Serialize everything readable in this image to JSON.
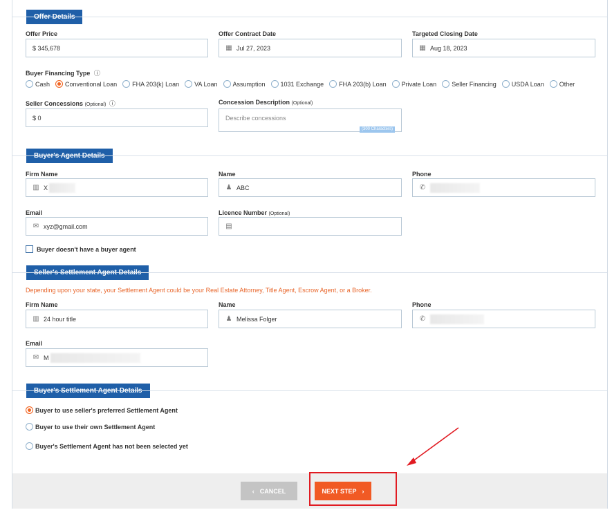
{
  "offer": {
    "title": "Offer Details",
    "offer_price_label": "Offer Price",
    "offer_price_value": "$ 345,678",
    "contract_date_label": "Offer Contract Date",
    "contract_date_value": "Jul 27, 2023",
    "closing_date_label": "Targeted Closing Date",
    "closing_date_value": "Aug 18, 2023",
    "financing_label": "Buyer Financing Type",
    "financing_options": [
      "Cash",
      "Conventional Loan",
      "FHA 203(k) Loan",
      "VA Loan",
      "Assumption",
      "1031 Exchange",
      "FHA 203(b) Loan",
      "Private Loan",
      "Seller Financing",
      "USDA Loan",
      "Other"
    ],
    "financing_selected": "Conventional Loan",
    "concessions_label": "Seller Concessions",
    "concessions_optional": "(Optional)",
    "concessions_value": "$ 0",
    "concession_desc_label": "Concession Description",
    "concession_desc_optional": "(Optional)",
    "concession_desc_placeholder": "Describe concessions",
    "char_counter": "(300 Characters)"
  },
  "buyer_agent": {
    "title": "Buyer's Agent Details",
    "firm_label": "Firm Name",
    "firm_value": "X",
    "name_label": "Name",
    "name_value": "ABC",
    "phone_label": "Phone",
    "email_label": "Email",
    "email_value": "xyz@gmail.com",
    "licence_label": "Licence Number",
    "licence_optional": "(Optional)",
    "no_agent_label": "Buyer doesn't have a buyer agent"
  },
  "seller_settlement": {
    "title": "Seller's Settlement Agent Details",
    "notice": "Depending upon your state, your Settlement Agent could be your Real Estate Attorney, Title Agent, Escrow Agent, or a Broker.",
    "firm_label": "Firm Name",
    "firm_value": "24 hour title",
    "name_label": "Name",
    "name_value": "Melissa Folger",
    "phone_label": "Phone",
    "email_label": "Email",
    "email_value": "M"
  },
  "buyer_settlement": {
    "title": "Buyer's Settlement Agent Details",
    "options": [
      "Buyer to use seller's preferred Settlement Agent",
      "Buyer to use their own Settlement Agent",
      "Buyer's Settlement Agent has not been selected yet"
    ],
    "selected_index": 0
  },
  "footer": {
    "cancel_label": "CANCEL",
    "next_label": "NEXT STEP"
  },
  "colors": {
    "accent": "#1f5fa8",
    "primary_button": "#f15a24",
    "annotation": "#e11b22"
  }
}
